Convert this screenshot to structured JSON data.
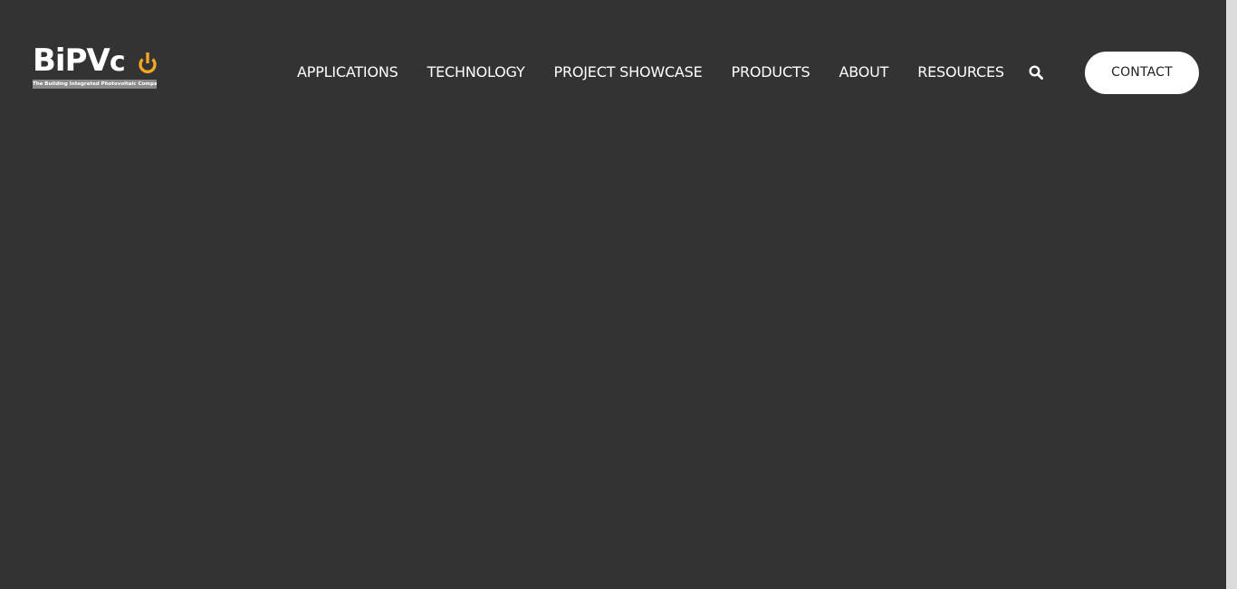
{
  "logo": {
    "word_main": "BiPV",
    "word_co": "c",
    "tagline": "The Building Integrated Photovoltaic Company",
    "accent_color": "#f5a623"
  },
  "nav": {
    "items": [
      {
        "label": "APPLICATIONS"
      },
      {
        "label": "TECHNOLOGY"
      },
      {
        "label": "PROJECT SHOWCASE"
      },
      {
        "label": "PRODUCTS"
      },
      {
        "label": "ABOUT"
      },
      {
        "label": "RESOURCES"
      }
    ],
    "search_icon": "search-icon",
    "contact_label": "CONTACT"
  },
  "colors": {
    "background": "#333333",
    "text": "#ffffff",
    "button_bg": "#ffffff",
    "button_text": "#222222"
  }
}
